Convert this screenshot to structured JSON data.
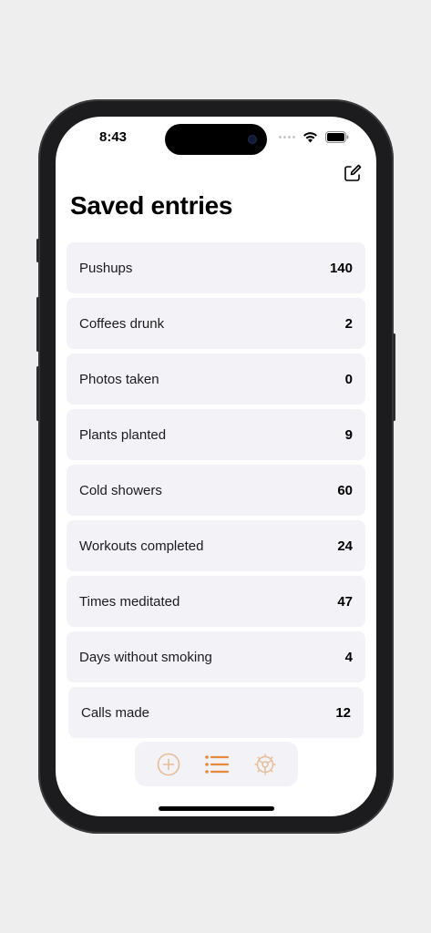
{
  "status_bar": {
    "time": "8:43"
  },
  "header": {
    "title": "Saved entries",
    "compose_icon": "compose-icon"
  },
  "entries": [
    {
      "label": "Pushups",
      "value": "140"
    },
    {
      "label": "Coffees drunk",
      "value": "2"
    },
    {
      "label": "Photos taken",
      "value": "0"
    },
    {
      "label": "Plants planted",
      "value": "9"
    },
    {
      "label": "Cold showers",
      "value": "60"
    },
    {
      "label": "Workouts completed",
      "value": "24"
    },
    {
      "label": "Times meditated",
      "value": "47"
    },
    {
      "label": "Days without smoking",
      "value": "4"
    },
    {
      "label": "Calls made",
      "value": "12"
    }
  ],
  "tab_bar": {
    "tabs": [
      {
        "icon": "plus-circle-icon",
        "active": false
      },
      {
        "icon": "list-icon",
        "active": true
      },
      {
        "icon": "settings-gear-icon",
        "active": false
      }
    ]
  },
  "colors": {
    "accent": "#e8883a",
    "accent_muted": "#e6bd98",
    "row_background": "#f2f2f7",
    "screen_background": "#ffffff",
    "page_background": "#eeeeee"
  }
}
